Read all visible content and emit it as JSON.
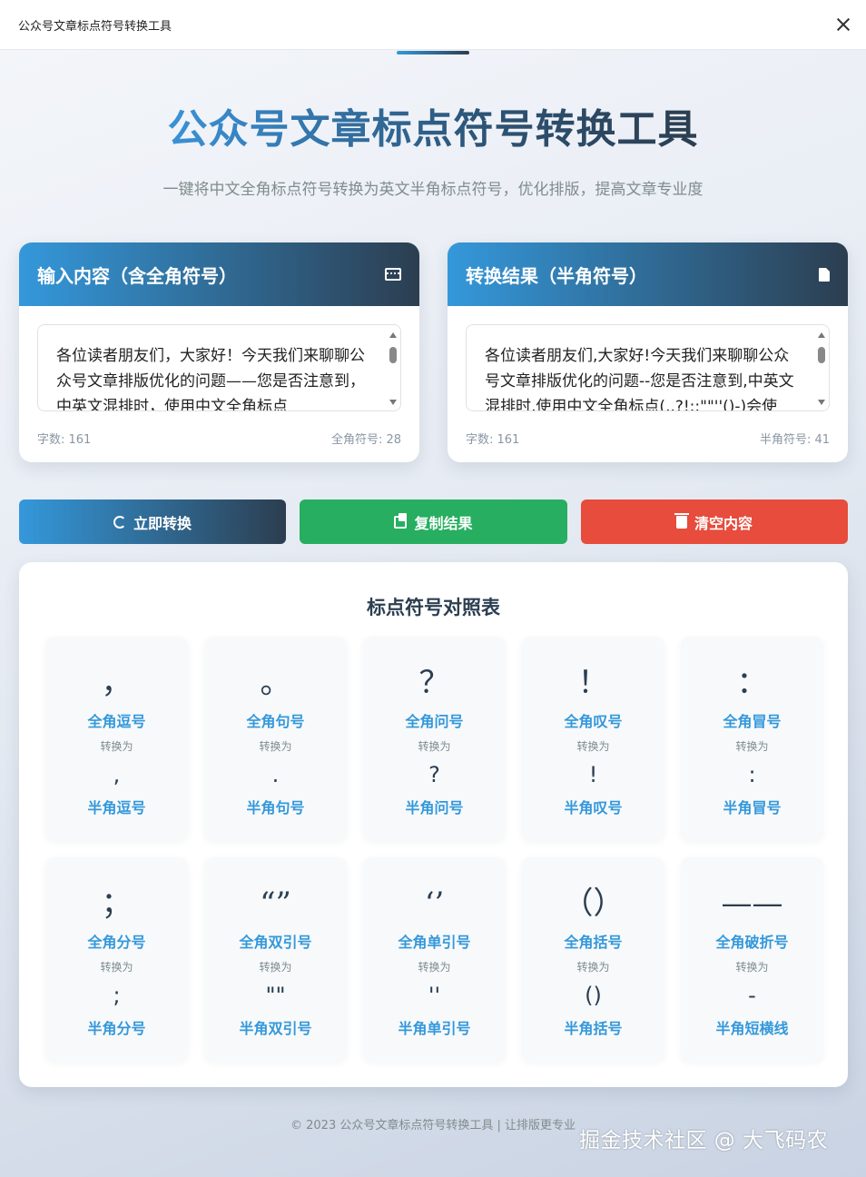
{
  "window": {
    "title": "公众号文章标点符号转换工具"
  },
  "hero": {
    "title": "公众号文章标点符号转换工具",
    "subtitle": "一键将中文全角标点符号转换为英文半角标点符号，优化排版，提高文章专业度"
  },
  "input_panel": {
    "title": "输入内容（含全角符号）",
    "icon": "keyboard-icon",
    "text": "各位读者朋友们，大家好！今天我们来聊聊公众号文章排版优化的问题——您是否注意到，中英文混排时，使用中文全角标点",
    "word_count": "字数: 161",
    "symbol_count": "全角符号: 28"
  },
  "output_panel": {
    "title": "转换结果（半角符号）",
    "icon": "file-icon",
    "text": "各位读者朋友们,大家好!今天我们来聊聊公众号文章排版优化的问题--您是否注意到,中英文混排时,使用中文全角标点(,.?!:;\"\"''()-)会使",
    "word_count": "字数: 161",
    "symbol_count": "半角符号: 41"
  },
  "actions": {
    "convert": "立即转换",
    "copy": "复制结果",
    "clear": "清空内容"
  },
  "reference": {
    "title": "标点符号对照表",
    "convert_label": "转换为",
    "items": [
      {
        "full": "，",
        "full_name": "全角逗号",
        "half": ",",
        "half_name": "半角逗号"
      },
      {
        "full": "。",
        "full_name": "全角句号",
        "half": ".",
        "half_name": "半角句号"
      },
      {
        "full": "？",
        "full_name": "全角问号",
        "half": "?",
        "half_name": "半角问号"
      },
      {
        "full": "！",
        "full_name": "全角叹号",
        "half": "!",
        "half_name": "半角叹号"
      },
      {
        "full": "：",
        "full_name": "全角冒号",
        "half": ":",
        "half_name": "半角冒号"
      },
      {
        "full": "；",
        "full_name": "全角分号",
        "half": ";",
        "half_name": "半角分号"
      },
      {
        "full": "“”",
        "full_name": "全角双引号",
        "half": "\"\"",
        "half_name": "半角双引号"
      },
      {
        "full": "‘’",
        "full_name": "全角单引号",
        "half": "''",
        "half_name": "半角单引号"
      },
      {
        "full": "（）",
        "full_name": "全角括号",
        "half": "()",
        "half_name": "半角括号"
      },
      {
        "full": "——",
        "full_name": "全角破折号",
        "half": "-",
        "half_name": "半角短横线"
      }
    ]
  },
  "footer": {
    "text": "© 2023 公众号文章标点符号转换工具 | 让排版更专业"
  },
  "watermark": {
    "text": "掘金技术社区 @ 大飞码农"
  },
  "colors": {
    "accent": "#3498db",
    "dark": "#2c3e50",
    "copy": "#27ae60",
    "clear": "#e74c3c"
  }
}
